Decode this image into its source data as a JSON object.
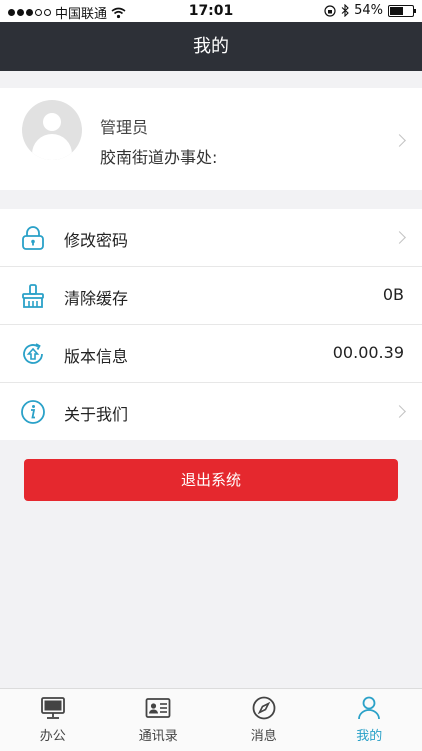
{
  "status_bar": {
    "carrier": "中国联通",
    "time": "17:01",
    "battery": "54%",
    "battery_level": 0.54
  },
  "nav": {
    "title": "我的"
  },
  "profile": {
    "name": "管理员",
    "org": "胶南街道办事处:"
  },
  "menu": {
    "items": [
      {
        "label": "修改密码",
        "icon": "lock-icon"
      },
      {
        "label": "清除缓存",
        "value": "0B",
        "icon": "broom-icon"
      },
      {
        "label": "版本信息",
        "value": "00.00.39",
        "icon": "update-icon"
      },
      {
        "label": "关于我们",
        "icon": "info-icon"
      }
    ]
  },
  "logout": {
    "label": "退出系统"
  },
  "tabs": [
    {
      "label": "办公",
      "icon": "monitor-icon"
    },
    {
      "label": "通讯录",
      "icon": "contact-card-icon"
    },
    {
      "label": "消息",
      "icon": "compass-icon"
    },
    {
      "label": "我的",
      "icon": "person-icon",
      "active": true
    }
  ],
  "colors": {
    "nav_bg": "#2d3037",
    "accent": "#2aa1c8",
    "logout": "#e5282e"
  }
}
